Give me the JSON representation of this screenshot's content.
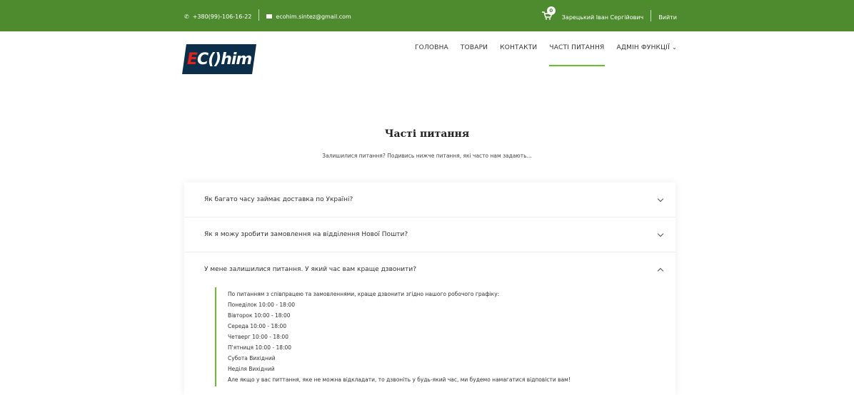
{
  "topbar": {
    "phone": "+380(99)-106-16-22",
    "email": "ecohim.sintez@gmail.com",
    "cart_count": "0",
    "user_name": "Зарецький Іван Сергійович",
    "logout": "Вийти"
  },
  "logo": {
    "text_a": "E",
    "text_b": "C",
    "text_c": "()",
    "text_d": "him"
  },
  "nav": {
    "items": [
      {
        "label": "ГОЛОВНА"
      },
      {
        "label": "ТОВАРИ"
      },
      {
        "label": "КОНТАКТИ"
      },
      {
        "label": "ЧАСТІ ПИТАННЯ"
      },
      {
        "label": "АДМІН ФУНКЦІЇ"
      }
    ]
  },
  "page": {
    "title": "Часті питання",
    "subtitle": "Залишилися питання? Подивись нижче питання, які часто нам задають..."
  },
  "faq": [
    {
      "question": "Як багато часу займає доставка по Україні?"
    },
    {
      "question": "Як я можу зробити замовлення на відділення Нової Пошти?"
    },
    {
      "question": "У мене залишилися питання. У який час вам краще дзвонити?",
      "answer": [
        "По питанням з співпрацею та замовленнями, краще дзвонити згідно нашого робочого графіку:",
        "Понеділок 10:00 - 18:00",
        "Вівторок 10:00 - 18:00",
        "Середа 10:00 - 18:00",
        "Четверг 10:00 - 18:00",
        "П'ятниця 10:00 - 18:00",
        "Субота Вихідний",
        "Неділя Вихідний",
        "Але якщо у вас питтання, яке не можна відкладати, то дзвоніть у будь-який час, ми будемо намагатися відповісти вам!"
      ]
    }
  ]
}
